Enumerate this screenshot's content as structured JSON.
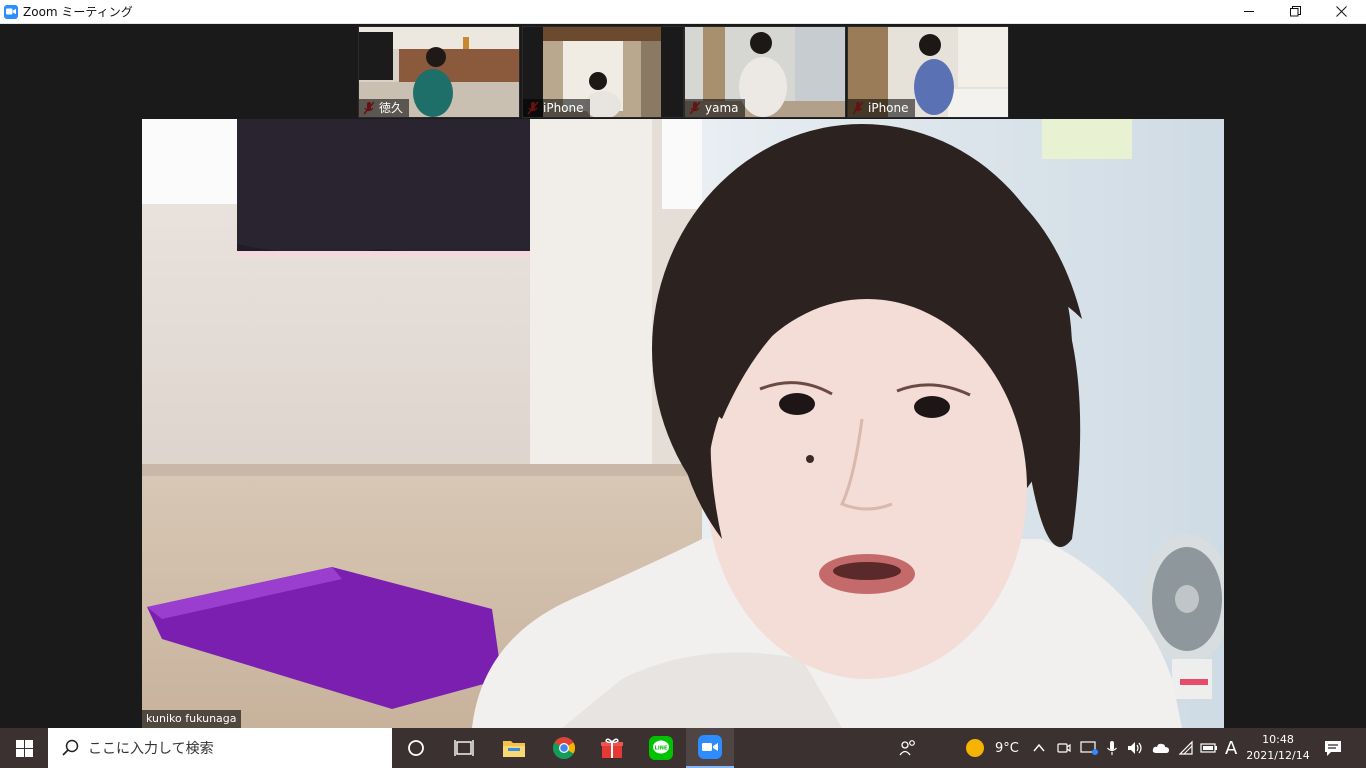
{
  "window": {
    "title": "Zoom ミーティング",
    "minimize_label": "—",
    "restore_label": "❐",
    "close_label": "✕"
  },
  "participants": [
    {
      "name": "徳久",
      "muted": true
    },
    {
      "name": "iPhone",
      "muted": true
    },
    {
      "name": "yama",
      "muted": true
    },
    {
      "name": "iPhone",
      "muted": true
    }
  ],
  "speaker": {
    "name": "kuniko fukunaga"
  },
  "taskbar": {
    "search_placeholder": "ここに入力して検索",
    "weather_temp": "9°C",
    "ime_label": "A",
    "time": "10:48",
    "date": "2021/12/14"
  },
  "colors": {
    "zoom_blue": "#2d8cff",
    "taskbar_bg": "#3a3130",
    "mute_red": "#e02828",
    "mat_purple": "#7a1fb0"
  }
}
